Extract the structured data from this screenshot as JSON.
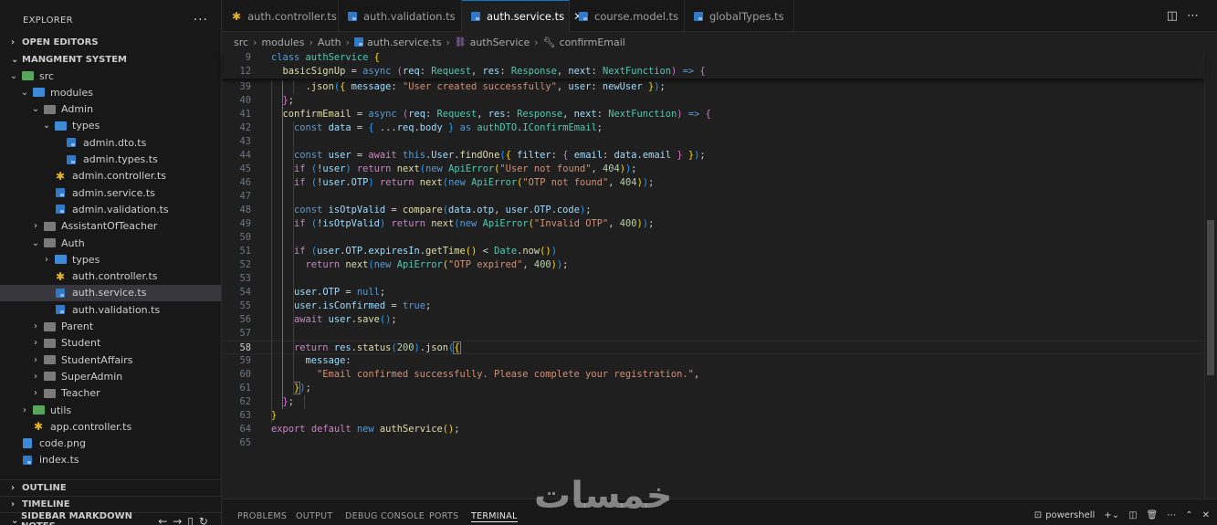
{
  "sidebar": {
    "title": "EXPLORER",
    "more": "···",
    "open_editors": "OPEN EDITORS",
    "project": "MANGMENT SYSTEM",
    "tree": [
      {
        "label": "src",
        "depth": 1,
        "kind": "folder-open",
        "icon": "src-folder-icon"
      },
      {
        "label": "modules",
        "depth": 2,
        "kind": "folder-open",
        "icon": "modules-folder-icon"
      },
      {
        "label": "Admin",
        "depth": 3,
        "kind": "folder-open",
        "icon": "folder-icon"
      },
      {
        "label": "types",
        "depth": 4,
        "kind": "folder-open",
        "icon": "types-folder-icon"
      },
      {
        "label": "admin.dto.ts",
        "depth": 5,
        "kind": "ts",
        "icon": "typescript-file-icon"
      },
      {
        "label": "admin.types.ts",
        "depth": 5,
        "kind": "ts",
        "icon": "typescript-file-icon"
      },
      {
        "label": "admin.controller.ts",
        "depth": 4,
        "kind": "gear",
        "icon": "controller-gear-icon"
      },
      {
        "label": "admin.service.ts",
        "depth": 4,
        "kind": "ts",
        "icon": "typescript-file-icon"
      },
      {
        "label": "admin.validation.ts",
        "depth": 4,
        "kind": "ts",
        "icon": "typescript-file-icon"
      },
      {
        "label": "AssistantOfTeacher",
        "depth": 3,
        "kind": "folder-closed",
        "icon": "folder-icon"
      },
      {
        "label": "Auth",
        "depth": 3,
        "kind": "folder-open",
        "icon": "folder-icon"
      },
      {
        "label": "types",
        "depth": 4,
        "kind": "folder-closed",
        "icon": "types-folder-icon"
      },
      {
        "label": "auth.controller.ts",
        "depth": 4,
        "kind": "gear",
        "icon": "controller-gear-icon"
      },
      {
        "label": "auth.service.ts",
        "depth": 4,
        "kind": "ts",
        "icon": "typescript-file-icon",
        "active": true
      },
      {
        "label": "auth.validation.ts",
        "depth": 4,
        "kind": "ts",
        "icon": "typescript-file-icon"
      },
      {
        "label": "Parent",
        "depth": 3,
        "kind": "folder-closed",
        "icon": "folder-icon"
      },
      {
        "label": "Student",
        "depth": 3,
        "kind": "folder-closed",
        "icon": "folder-icon"
      },
      {
        "label": "StudentAffairs",
        "depth": 3,
        "kind": "folder-closed",
        "icon": "folder-icon"
      },
      {
        "label": "SuperAdmin",
        "depth": 3,
        "kind": "folder-closed",
        "icon": "folder-icon"
      },
      {
        "label": "Teacher",
        "depth": 3,
        "kind": "folder-closed",
        "icon": "folder-icon"
      },
      {
        "label": "utils",
        "depth": 2,
        "kind": "folder-closed",
        "icon": "utils-folder-icon"
      },
      {
        "label": "app.controller.ts",
        "depth": 2,
        "kind": "gear",
        "icon": "controller-gear-icon"
      },
      {
        "label": "code.png",
        "depth": 1,
        "kind": "img",
        "icon": "image-file-icon"
      },
      {
        "label": "index.ts",
        "depth": 1,
        "kind": "ts",
        "icon": "typescript-file-icon"
      }
    ],
    "outline": "OUTLINE",
    "timeline": "TIMELINE",
    "markdown_notes": "SIDEBAR MARKDOWN NOTES"
  },
  "tabs": [
    {
      "label": "auth.controller.ts",
      "icon": "controller-gear-icon"
    },
    {
      "label": "auth.validation.ts",
      "icon": "typescript-file-icon"
    },
    {
      "label": "auth.service.ts",
      "icon": "typescript-file-icon",
      "active": true
    },
    {
      "label": "course.model.ts",
      "icon": "typescript-file-icon"
    },
    {
      "label": "globalTypes.ts",
      "icon": "typescript-file-icon"
    }
  ],
  "breadcrumb": [
    "src",
    "modules",
    "Auth",
    "auth.service.ts",
    "authService",
    "confirmEmail"
  ],
  "code": {
    "sticky": [
      {
        "n": "9",
        "html": "<span class=\"kw\">class</span> <span class=\"ty\">authService</span> <span class=\"br1\">{</span>"
      },
      {
        "n": "12",
        "html": "  <span class=\"fn\">basicSignUp</span> = <span class=\"kw\">async</span> <span class=\"br2\">(</span><span class=\"vr\">req</span>: <span class=\"ty\">Request</span>, <span class=\"vr\">res</span>: <span class=\"ty\">Response</span>, <span class=\"vr\">next</span>: <span class=\"ty\">NextFunction</span><span class=\"br2\">)</span> <span class=\"kw\">=&gt;</span> <span class=\"br2\">{</span>"
      }
    ],
    "lines": [
      {
        "n": "39",
        "html": "      .<span class=\"fn\">json</span><span class=\"br3\">(</span><span class=\"br1\">{</span> <span class=\"vr\">message</span>: <span class=\"st\">\"User created successfully\"</span>, <span class=\"vr\">user</span>: <span class=\"vr\">newUser</span> <span class=\"br1\">}</span><span class=\"br3\">)</span>;"
      },
      {
        "n": "40",
        "html": "  <span class=\"br2\">}</span>;"
      },
      {
        "n": "41",
        "html": "  <span class=\"fn\">confirmEmail</span> = <span class=\"kw\">async</span> <span class=\"br2\">(</span><span class=\"vr\">req</span>: <span class=\"ty\">Request</span>, <span class=\"vr\">res</span>: <span class=\"ty\">Response</span>, <span class=\"vr\">next</span>: <span class=\"ty\">NextFunction</span><span class=\"br2\">)</span> <span class=\"kw\">=&gt;</span> <span class=\"br2\">{</span>"
      },
      {
        "n": "42",
        "html": "    <span class=\"kw\">const</span> <span class=\"vr\">data</span> = <span class=\"br3\">{</span> ...<span class=\"vr\">req</span>.<span class=\"vr\">body</span> <span class=\"br3\">}</span> <span class=\"kw\">as</span> <span class=\"ty\">authDTO</span>.<span class=\"ty\">IConfirmEmail</span>;"
      },
      {
        "n": "43",
        "html": ""
      },
      {
        "n": "44",
        "html": "    <span class=\"kw\">const</span> <span class=\"vr\">user</span> = <span class=\"ctrl\">await</span> <span class=\"kw\">this</span>.<span class=\"vr\">User</span>.<span class=\"fn\">findOne</span><span class=\"br3\">(</span><span class=\"br1\">{</span> <span class=\"vr\">filter</span>: <span class=\"br2\">{</span> <span class=\"vr\">email</span>: <span class=\"vr\">data</span>.<span class=\"vr\">email</span> <span class=\"br2\">}</span> <span class=\"br1\">}</span><span class=\"br3\">)</span>;"
      },
      {
        "n": "45",
        "html": "    <span class=\"ctrl\">if</span> <span class=\"br3\">(</span>!<span class=\"vr\">user</span><span class=\"br3\">)</span> <span class=\"ctrl\">return</span> <span class=\"fn\">next</span><span class=\"br3\">(</span><span class=\"kw\">new</span> <span class=\"ty\">ApiError</span><span class=\"br1\">(</span><span class=\"st\">\"User not found\"</span>, <span class=\"nu\">404</span><span class=\"br1\">)</span><span class=\"br3\">)</span>;"
      },
      {
        "n": "46",
        "html": "    <span class=\"ctrl\">if</span> <span class=\"br3\">(</span>!<span class=\"vr\">user</span>.<span class=\"vr\">OTP</span><span class=\"br3\">)</span> <span class=\"ctrl\">return</span> <span class=\"fn\">next</span><span class=\"br3\">(</span><span class=\"kw\">new</span> <span class=\"ty\">ApiError</span><span class=\"br1\">(</span><span class=\"st\">\"OTP not found\"</span>, <span class=\"nu\">404</span><span class=\"br1\">)</span><span class=\"br3\">)</span>;"
      },
      {
        "n": "47",
        "html": ""
      },
      {
        "n": "48",
        "html": "    <span class=\"kw\">const</span> <span class=\"vr\">isOtpValid</span> = <span class=\"fn\">compare</span><span class=\"br3\">(</span><span class=\"vr\">data</span>.<span class=\"vr\">otp</span>, <span class=\"vr\">user</span>.<span class=\"vr\">OTP</span>.<span class=\"vr\">code</span><span class=\"br3\">)</span>;"
      },
      {
        "n": "49",
        "html": "    <span class=\"ctrl\">if</span> <span class=\"br3\">(</span>!<span class=\"vr\">isOtpValid</span><span class=\"br3\">)</span> <span class=\"ctrl\">return</span> <span class=\"fn\">next</span><span class=\"br3\">(</span><span class=\"kw\">new</span> <span class=\"ty\">ApiError</span><span class=\"br1\">(</span><span class=\"st\">\"Invalid OTP\"</span>, <span class=\"nu\">400</span><span class=\"br1\">)</span><span class=\"br3\">)</span>;"
      },
      {
        "n": "50",
        "html": ""
      },
      {
        "n": "51",
        "html": "    <span class=\"ctrl\">if</span> <span class=\"br3\">(</span><span class=\"vr\">user</span>.<span class=\"vr\">OTP</span>.<span class=\"vr\">expiresIn</span>.<span class=\"fn\">getTime</span><span class=\"br1\">()</span> &lt; <span class=\"ty\">Date</span>.<span class=\"fn\">now</span><span class=\"br1\">()</span><span class=\"br3\">)</span>"
      },
      {
        "n": "52",
        "html": "      <span class=\"ctrl\">return</span> <span class=\"fn\">next</span><span class=\"br3\">(</span><span class=\"kw\">new</span> <span class=\"ty\">ApiError</span><span class=\"br1\">(</span><span class=\"st\">\"OTP expired\"</span>, <span class=\"nu\">400</span><span class=\"br1\">)</span><span class=\"br3\">)</span>;"
      },
      {
        "n": "53",
        "html": ""
      },
      {
        "n": "54",
        "html": "    <span class=\"vr\">user</span>.<span class=\"vr\">OTP</span> = <span class=\"kw\">null</span>;"
      },
      {
        "n": "55",
        "html": "    <span class=\"vr\">user</span>.<span class=\"vr\">isConfirmed</span> = <span class=\"kw\">true</span>;"
      },
      {
        "n": "56",
        "html": "    <span class=\"ctrl\">await</span> <span class=\"vr\">user</span>.<span class=\"fn\">save</span><span class=\"br3\">()</span>;"
      },
      {
        "n": "57",
        "html": ""
      },
      {
        "n": "58",
        "html": "    <span class=\"ctrl\">return</span> <span class=\"vr\">res</span>.<span class=\"fn\">status</span><span class=\"br3\">(</span><span class=\"nu\">200</span><span class=\"br3\">)</span>.<span class=\"fn\">json</span><span class=\"br3\">(</span><span class=\"br1 bracket-box\">{</span>",
        "current": true
      },
      {
        "n": "59",
        "html": "      <span class=\"vr\">message</span>:"
      },
      {
        "n": "60",
        "html": "        <span class=\"st\">\"Email confirmed successfully. Please complete your registration.\"</span>,"
      },
      {
        "n": "61",
        "html": "    <span class=\"br1 bracket-box\">}</span><span class=\"br3\">)</span>;"
      },
      {
        "n": "62",
        "html": "  <span class=\"br2\">}</span>;"
      },
      {
        "n": "63",
        "html": "<span class=\"br1\">}</span>"
      },
      {
        "n": "64",
        "html": "<span class=\"ctrl\">export</span> <span class=\"ctrl\">default</span> <span class=\"kw\">new</span> <span class=\"fn\">authService</span><span class=\"br1\">()</span>;"
      },
      {
        "n": "65",
        "html": ""
      }
    ]
  },
  "panel": {
    "tabs": [
      "PROBLEMS",
      "OUTPUT",
      "DEBUG CONSOLE",
      "PORTS",
      "TERMINAL"
    ],
    "active": "TERMINAL",
    "terminal": "powershell"
  },
  "watermark": "خمسات"
}
